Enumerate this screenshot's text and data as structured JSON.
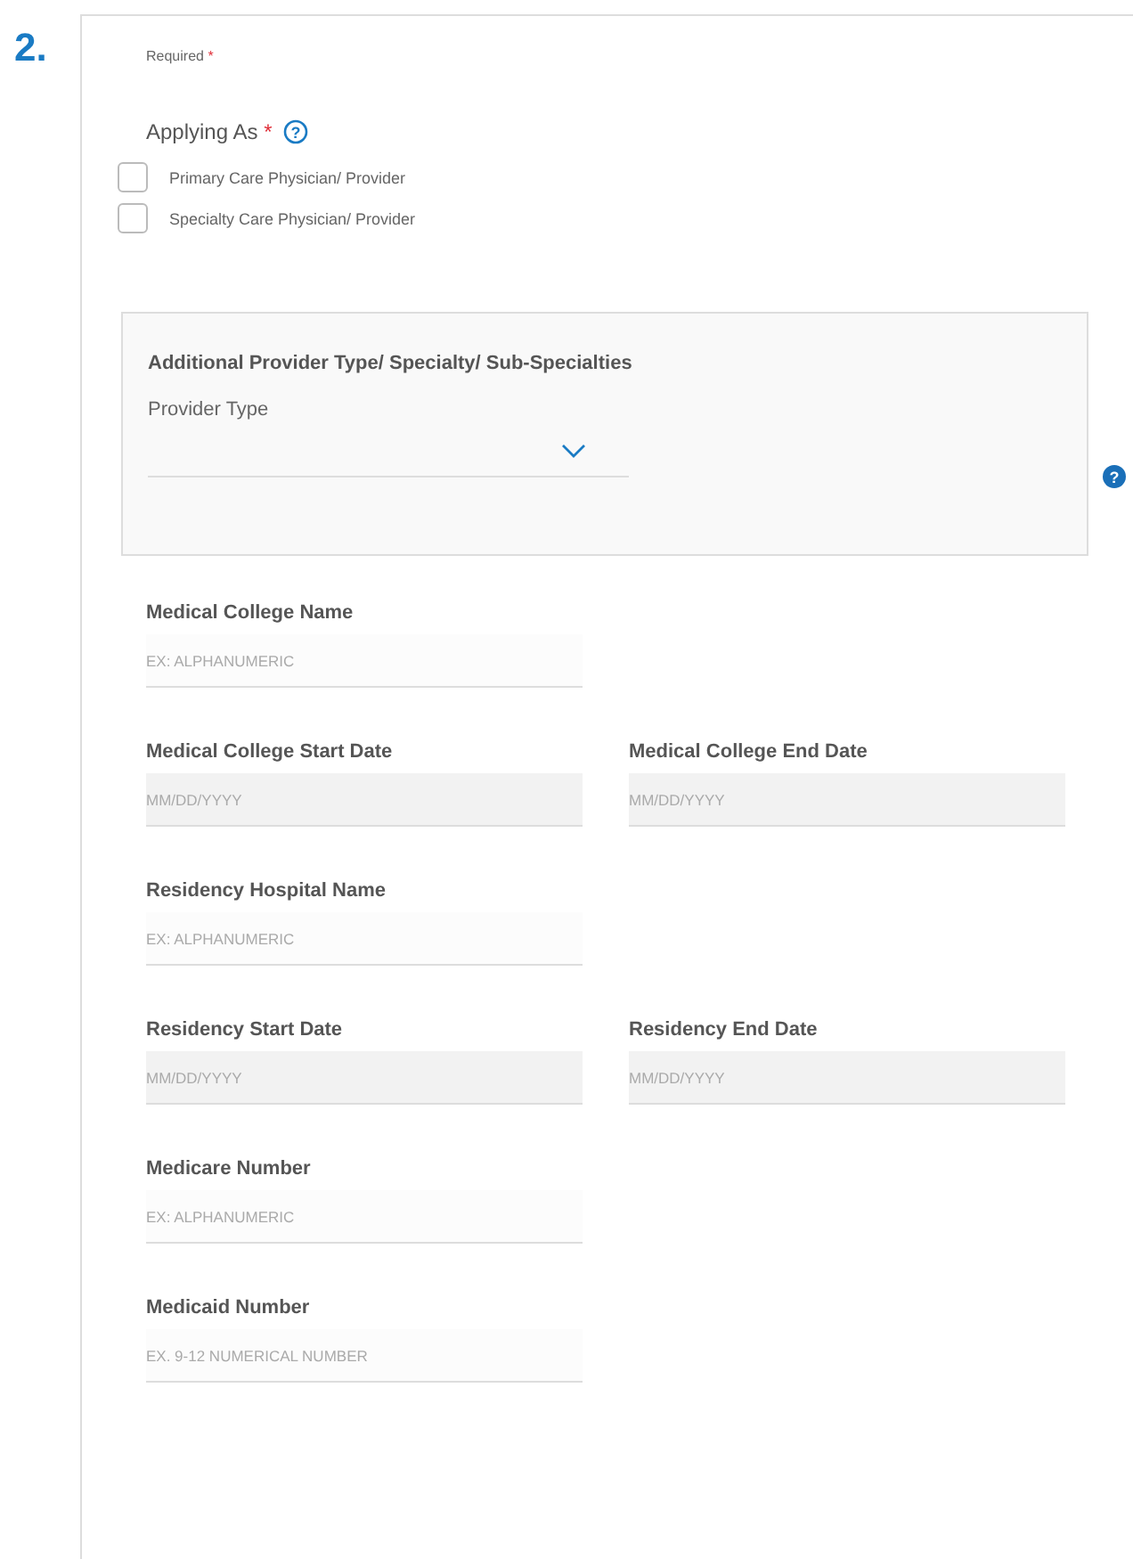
{
  "step_number": "2.",
  "required_note": {
    "text": "Required",
    "mark": "*"
  },
  "applying_as": {
    "label": "Applying As",
    "mark": "*",
    "help_icon": "?",
    "options": [
      {
        "label": "Primary Care Physician/ Provider",
        "checked": false
      },
      {
        "label": "Specialty Care Physician/ Provider",
        "checked": false
      }
    ]
  },
  "provider_panel": {
    "title": "Additional Provider Type/ Specialty/ Sub-Specialties",
    "field_label": "Provider Type",
    "help_icon": "?"
  },
  "field_rows": [
    [
      {
        "label": "Medical College Name",
        "placeholder": "EX: ALPHANUMERIC",
        "kind": "text"
      }
    ],
    [
      {
        "label": "Medical College Start Date",
        "placeholder": "MM/DD/YYYY",
        "kind": "date"
      },
      {
        "label": "Medical College End Date",
        "placeholder": "MM/DD/YYYY",
        "kind": "date"
      }
    ],
    [
      {
        "label": "Residency Hospital Name",
        "placeholder": "EX: ALPHANUMERIC",
        "kind": "text"
      }
    ],
    [
      {
        "label": "Residency Start Date",
        "placeholder": "MM/DD/YYYY",
        "kind": "date"
      },
      {
        "label": "Residency End Date",
        "placeholder": "MM/DD/YYYY",
        "kind": "date"
      }
    ],
    [
      {
        "label": "Medicare Number",
        "placeholder": "EX: ALPHANUMERIC",
        "kind": "text"
      }
    ],
    [
      {
        "label": "Medicaid Number",
        "placeholder": "EX. 9-12 NUMERICAL NUMBER",
        "kind": "text"
      }
    ]
  ]
}
